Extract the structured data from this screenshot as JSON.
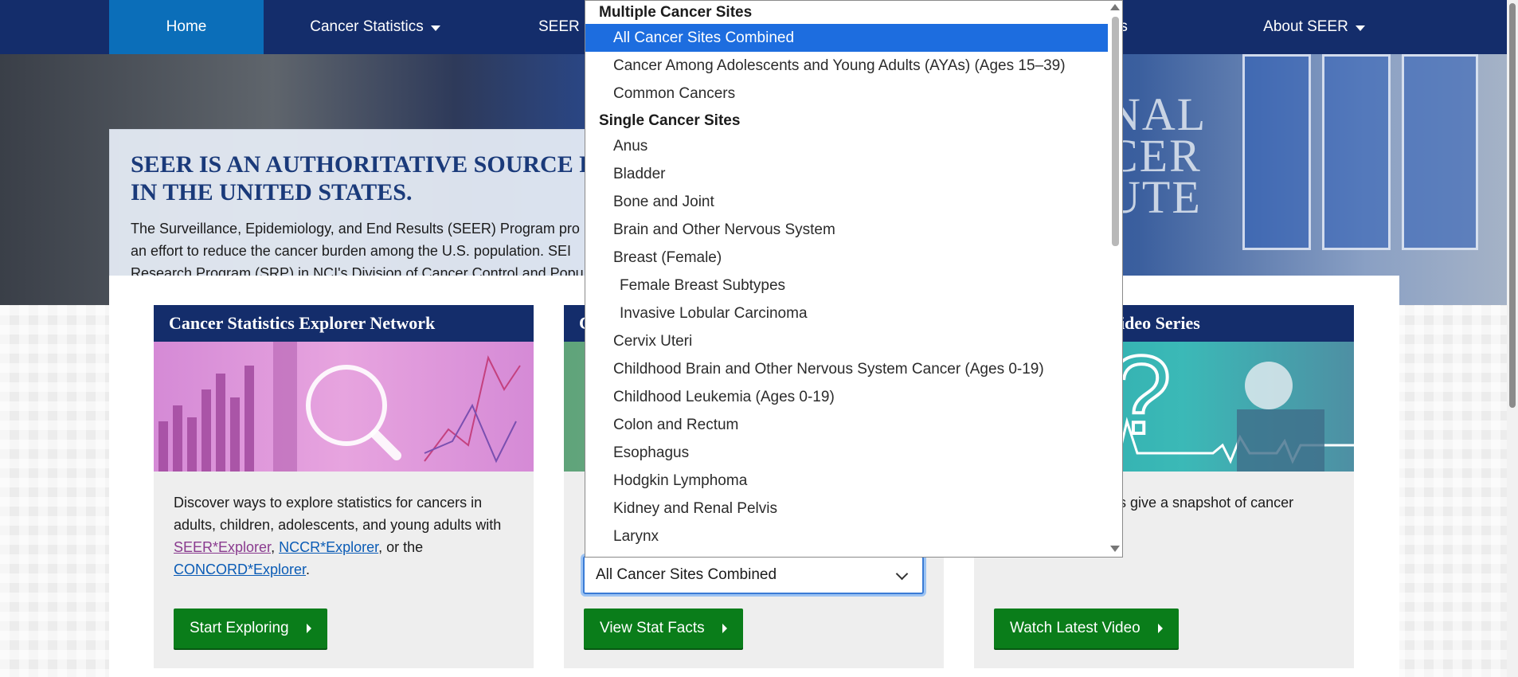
{
  "nav": {
    "items": [
      {
        "label": "Home",
        "has_caret": false
      },
      {
        "label": "Cancer Statistics",
        "has_caret": true
      },
      {
        "label": "SEER D",
        "has_caret": false
      },
      {
        "label": "ents",
        "has_caret": false
      },
      {
        "label": "About SEER",
        "has_caret": true
      }
    ]
  },
  "hero": {
    "title_line1": "SEER IS AN AUTHORITATIVE SOURCE FO",
    "title_line2": "IN THE UNITED STATES.",
    "desc_line1": "The Surveillance, Epidemiology, and End Results (SEER) Program pro",
    "desc_line2": "an effort to reduce the cancer burden among the U.S. population. SEI",
    "desc_line3": "Research Program (SRP) in NCI's Division of Cancer Control and Popu",
    "logo_line1": "NAL",
    "logo_line2": "CER",
    "logo_line3": "UTE"
  },
  "cards": {
    "explorer": {
      "title": "Cancer Statistics Explorer Network",
      "text_before": "Discover ways to explore statistics for cancers in adults, children, adolescents, and young adults with ",
      "link1": "SEER*Explorer",
      "sep1": ", ",
      "link2": "NCCR*Explorer",
      "sep2": ", or the ",
      "link3": "CONCORD*Explorer",
      "text_after": ".",
      "button": "Start Exploring"
    },
    "statfacts": {
      "title": "C",
      "select_value": "All Cancer Sites Combined",
      "button": "View Stat Facts"
    },
    "video": {
      "title": "ideo Series",
      "text": "os give a snapshot of cancer",
      "button": "Watch Latest Video"
    }
  },
  "dropdown": {
    "groups": [
      {
        "label": "Multiple Cancer Sites"
      },
      {
        "label": "Single Cancer Sites"
      }
    ],
    "options": [
      {
        "label": "All Cancer Sites Combined",
        "group": 0,
        "selected": true,
        "sub": false
      },
      {
        "label": "Cancer Among Adolescents and Young Adults (AYAs) (Ages 15–39)",
        "group": 0,
        "selected": false,
        "sub": false
      },
      {
        "label": "Common Cancers",
        "group": 0,
        "selected": false,
        "sub": false
      },
      {
        "label": "Anus",
        "group": 1,
        "selected": false,
        "sub": false
      },
      {
        "label": "Bladder",
        "group": 1,
        "selected": false,
        "sub": false
      },
      {
        "label": "Bone and Joint",
        "group": 1,
        "selected": false,
        "sub": false
      },
      {
        "label": "Brain and Other Nervous System",
        "group": 1,
        "selected": false,
        "sub": false
      },
      {
        "label": "Breast (Female)",
        "group": 1,
        "selected": false,
        "sub": false
      },
      {
        "label": "Female Breast Subtypes",
        "group": 1,
        "selected": false,
        "sub": true
      },
      {
        "label": "Invasive Lobular Carcinoma",
        "group": 1,
        "selected": false,
        "sub": true
      },
      {
        "label": "Cervix Uteri",
        "group": 1,
        "selected": false,
        "sub": false
      },
      {
        "label": "Childhood Brain and Other Nervous System Cancer (Ages 0-19)",
        "group": 1,
        "selected": false,
        "sub": false
      },
      {
        "label": "Childhood Leukemia (Ages 0-19)",
        "group": 1,
        "selected": false,
        "sub": false
      },
      {
        "label": "Colon and Rectum",
        "group": 1,
        "selected": false,
        "sub": false
      },
      {
        "label": "Esophagus",
        "group": 1,
        "selected": false,
        "sub": false
      },
      {
        "label": "Hodgkin Lymphoma",
        "group": 1,
        "selected": false,
        "sub": false
      },
      {
        "label": "Kidney and Renal Pelvis",
        "group": 1,
        "selected": false,
        "sub": false
      },
      {
        "label": "Larynx",
        "group": 1,
        "selected": false,
        "sub": false
      }
    ]
  },
  "colors": {
    "nav_bg": "#142d6b",
    "nav_active": "#0b6eb9",
    "button_green": "#0a7d1a",
    "selected_option": "#1d6ddf",
    "link": "#0a5bb5",
    "visited_link": "#8a3b8f"
  }
}
